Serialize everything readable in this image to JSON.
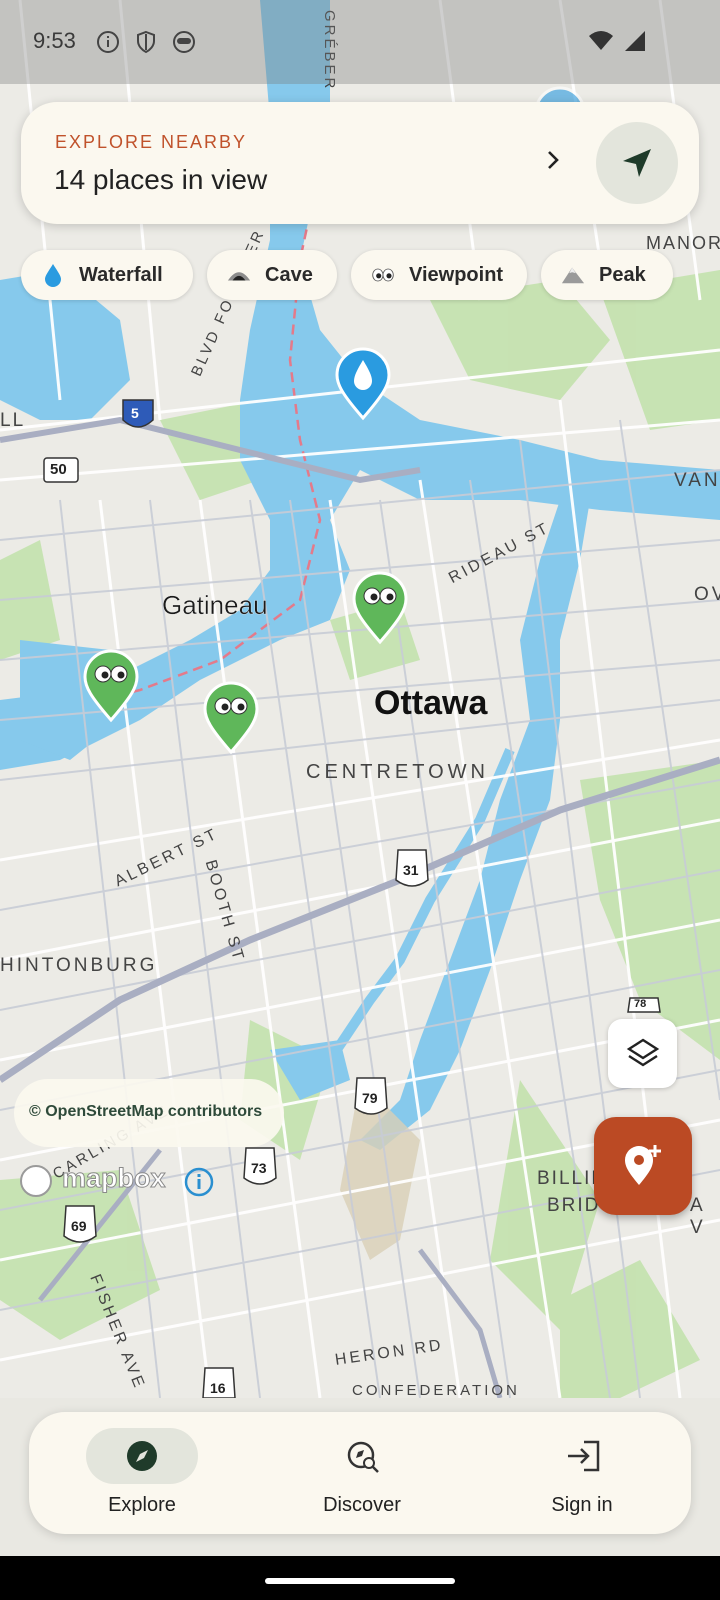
{
  "status_bar": {
    "time": "9:53"
  },
  "explore_card": {
    "label": "EXPLORE NEARBY",
    "count_text": "14 places in view"
  },
  "chips": [
    {
      "label": "Waterfall",
      "icon": "water-drop-icon"
    },
    {
      "label": "Cave",
      "icon": "cave-icon"
    },
    {
      "label": "Viewpoint",
      "icon": "eyes-icon"
    },
    {
      "label": "Peak",
      "icon": "mountain-icon"
    }
  ],
  "map": {
    "city_labels": [
      "Gatineau",
      "Ottawa"
    ],
    "district_labels": [
      "CENTRETOWN",
      "HINTONBURG",
      "MANOR",
      "VAN",
      "OV",
      "BILLIN",
      "BRIDG",
      "A V",
      "LL"
    ],
    "street_labels": [
      "RIDEAU ST",
      "ALBERT ST",
      "BOOTH ST",
      "FISHER AVE",
      "HERON RD",
      "BLVD FOURNIER",
      "GRÉBER",
      "CONFEDERATION",
      "CARLING AVE"
    ],
    "route_shields": [
      "5",
      "50",
      "31",
      "79",
      "73",
      "69",
      "16",
      "78"
    ],
    "attribution": "© OpenStreetMap contributors",
    "logo_text": "mapbox"
  },
  "bottom_nav": [
    {
      "label": "Explore",
      "icon": "compass-icon",
      "active": true
    },
    {
      "label": "Discover",
      "icon": "discover-search-icon",
      "active": false
    },
    {
      "label": "Sign in",
      "icon": "sign-in-icon",
      "active": false
    }
  ],
  "colors": {
    "accent": "#bb4a24",
    "water": "#7fc6ea",
    "park": "#bfe0a8",
    "land": "#ecebe6",
    "card": "#fbf8ef",
    "pin_green": "#5fb75a",
    "pin_blue": "#2a9be0"
  }
}
